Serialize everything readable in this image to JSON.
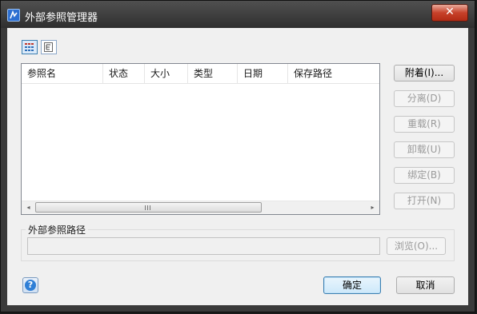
{
  "window": {
    "title": "外部参照管理器",
    "close_glyph": "✕"
  },
  "toolbar": {
    "list_view_icon": "list-view-icon",
    "tree_view_icon": "tree-view-icon"
  },
  "list": {
    "columns": [
      "参照名",
      "状态",
      "大小",
      "类型",
      "日期",
      "保存路径"
    ],
    "rows": [],
    "scroll_left_glyph": "◂",
    "scroll_right_glyph": "▸"
  },
  "side_buttons": {
    "attach": "附着(I)...",
    "detach": "分离(D)",
    "reload": "重载(R)",
    "unload": "卸载(U)",
    "bind": "绑定(B)",
    "open": "打开(N)"
  },
  "path_group": {
    "label": "外部参照路径",
    "value": "",
    "browse": "浏览(O)..."
  },
  "footer": {
    "help_glyph": "?",
    "ok": "确定",
    "cancel": "取消"
  }
}
